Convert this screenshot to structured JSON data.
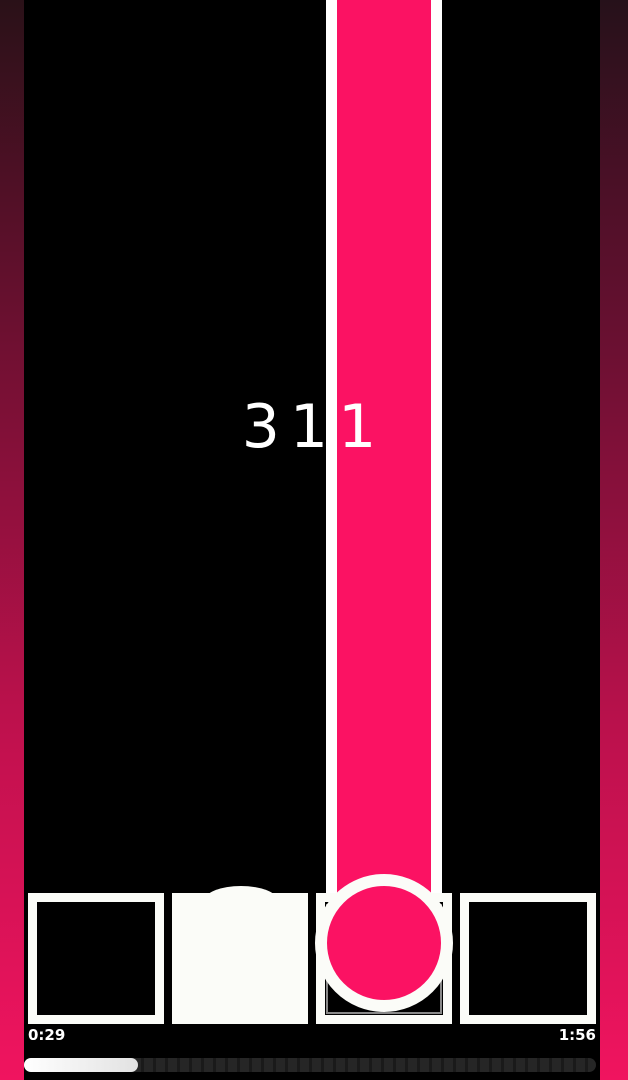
{
  "game": {
    "score": "311",
    "accent_color": "#fb1263",
    "active_lane": 3,
    "pads": [
      {
        "lane": 1,
        "state": "idle"
      },
      {
        "lane": 2,
        "state": "pressed"
      },
      {
        "lane": 3,
        "state": "hit"
      },
      {
        "lane": 4,
        "state": "idle"
      }
    ]
  },
  "playback": {
    "current_time": "0:29",
    "total_time": "1:56",
    "progress": 0.2
  }
}
